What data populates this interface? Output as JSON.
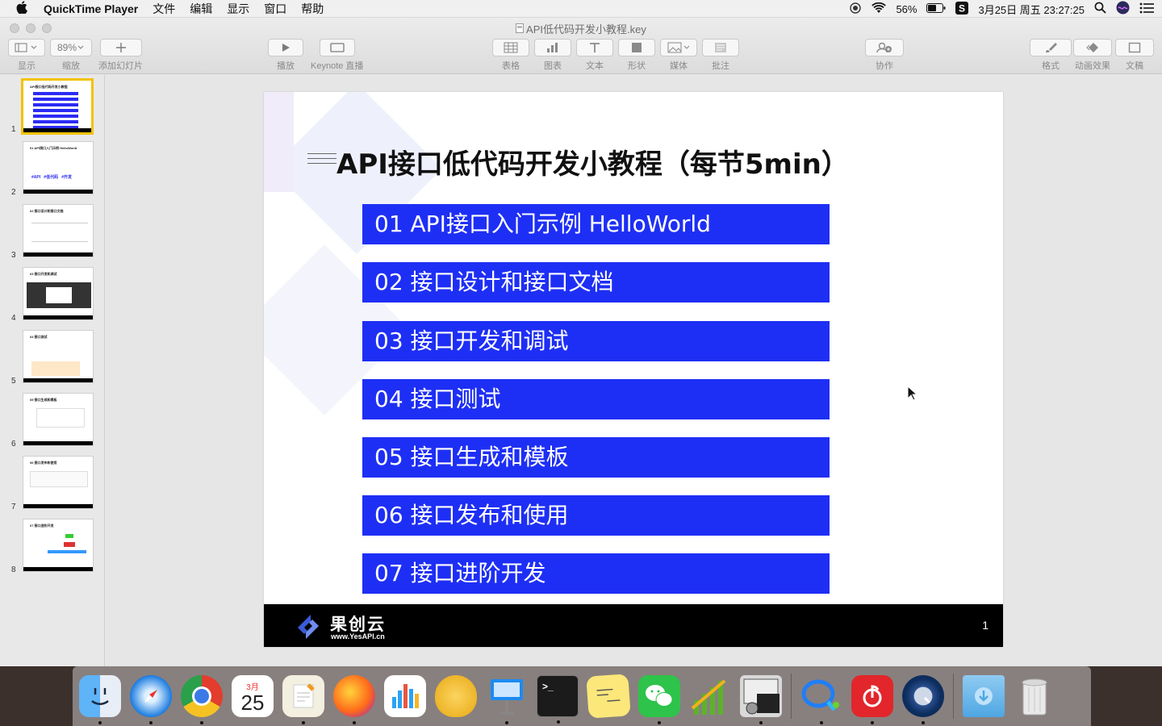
{
  "menubar": {
    "apple": "",
    "app_name": "QuickTime Player",
    "menus": [
      "文件",
      "编辑",
      "显示",
      "窗口",
      "帮助"
    ],
    "battery": "56%",
    "datetime": "3月25日 周五 23:27:25"
  },
  "window": {
    "title": "API低代码开发小教程.key",
    "toolbar": {
      "view_label": "显示",
      "zoom_value": "89%",
      "zoom_label": "缩放",
      "add_slide_label": "添加幻灯片",
      "play_label": "播放",
      "keynote_live_label": "Keynote 直播",
      "table_label": "表格",
      "chart_label": "图表",
      "text_label": "文本",
      "shape_label": "形状",
      "media_label": "媒体",
      "comment_label": "批注",
      "collab_label": "协作",
      "format_label": "格式",
      "animate_label": "动画效果",
      "document_label": "文稿"
    }
  },
  "sidebar": {
    "slides": [
      {
        "num": "1"
      },
      {
        "num": "2"
      },
      {
        "num": "3"
      },
      {
        "num": "4"
      },
      {
        "num": "5"
      },
      {
        "num": "6"
      },
      {
        "num": "7"
      },
      {
        "num": "8"
      }
    ]
  },
  "slide": {
    "title": "API接口低代码开发小教程（每节5min）",
    "items": [
      "01 API接口入门示例 HelloWorld",
      "02 接口设计和接口文档",
      "03 接口开发和调试",
      "04 接口测试",
      "05 接口生成和模板",
      "06 接口发布和使用",
      "07 接口进阶开发"
    ],
    "logo_name": "果创云",
    "logo_url": "www.YesAPI.cn",
    "page_number": "1"
  },
  "dock": {
    "calendar_month": "3月",
    "calendar_day": "25"
  }
}
